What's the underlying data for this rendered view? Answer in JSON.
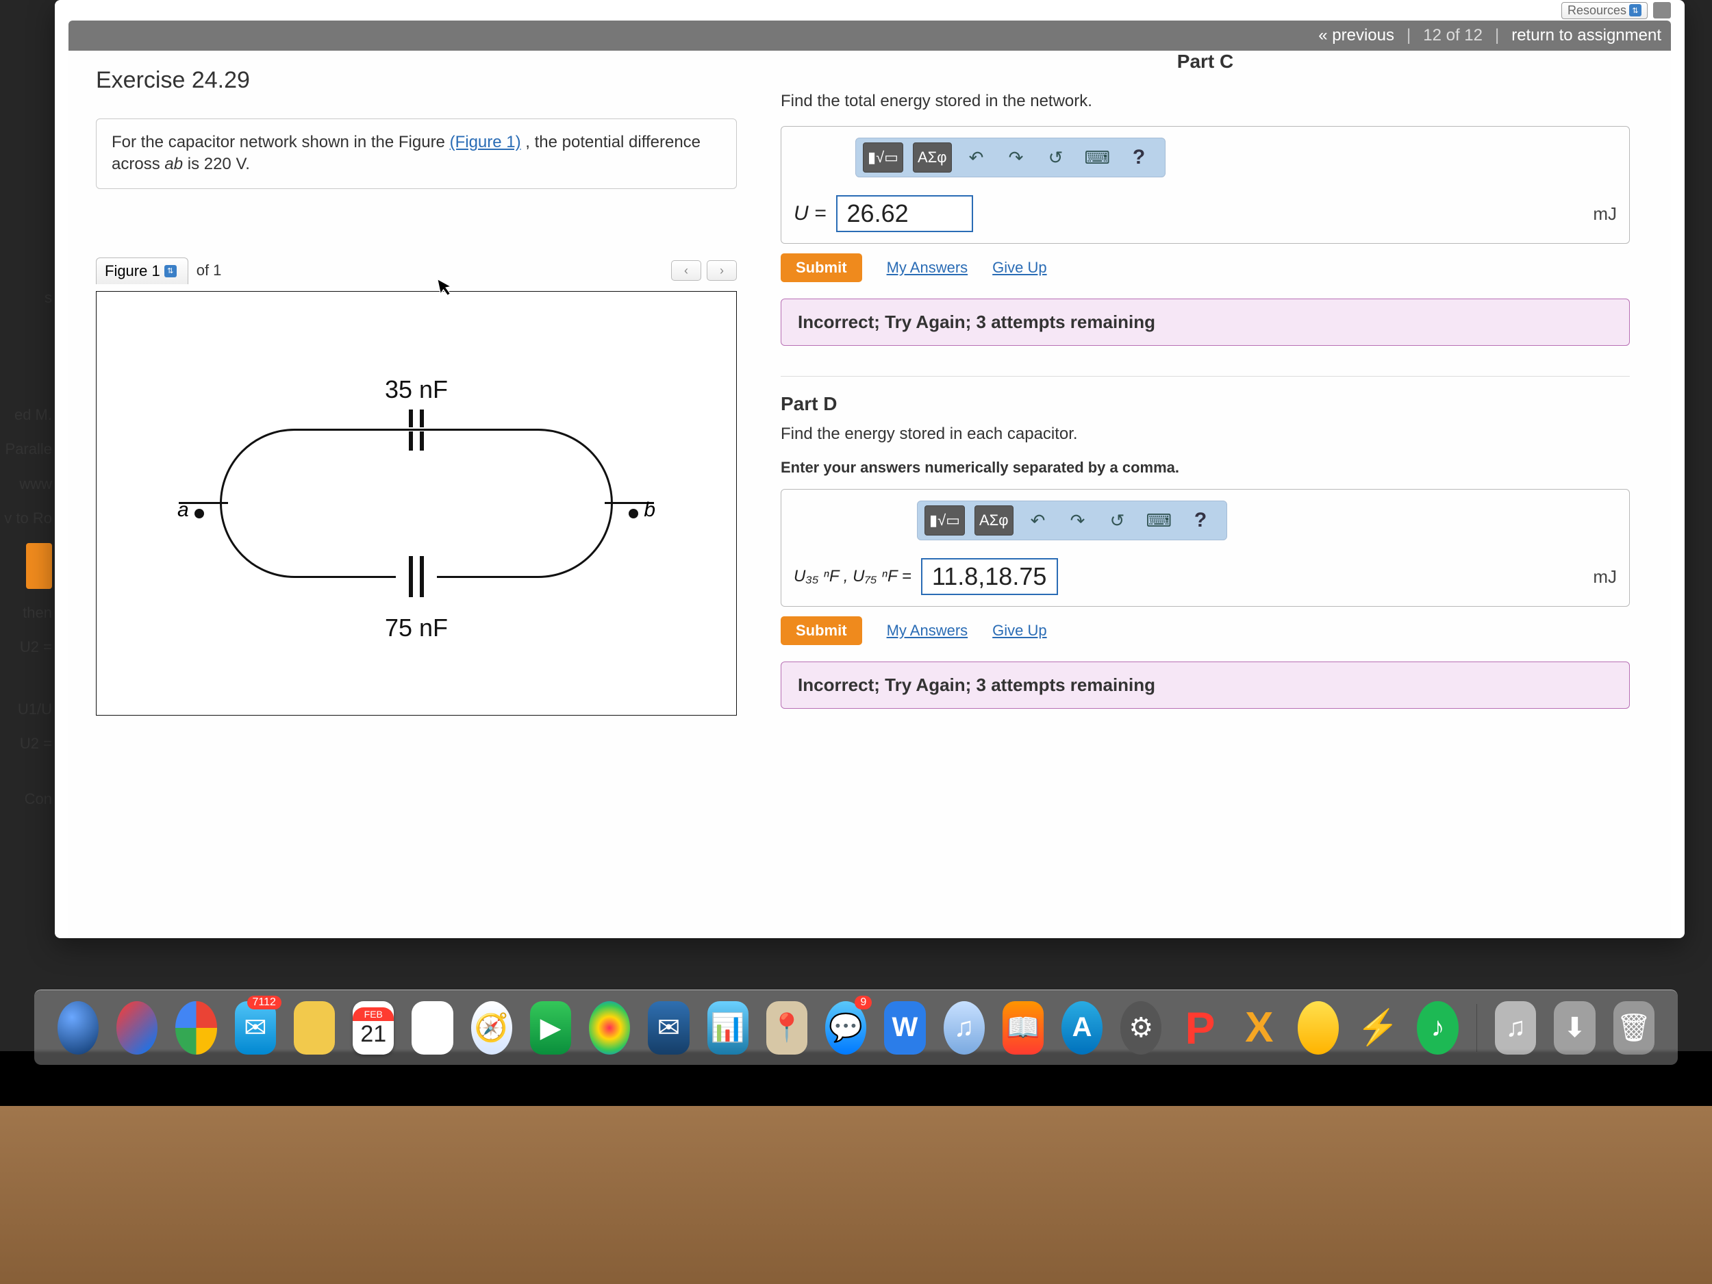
{
  "topbar": {
    "resources": "Resources"
  },
  "nav": {
    "prev": "« previous",
    "pos": "12 of 12",
    "return": "return to assignment"
  },
  "exercise": {
    "title": "Exercise 24.29",
    "prompt_pre": "For the capacitor network shown in the Figure ",
    "prompt_link": "(Figure 1)",
    "prompt_post": " , the potential difference across ",
    "prompt_ab": "ab",
    "prompt_tail": " is 220 V.",
    "fig_tab": "Figure 1",
    "fig_of": "of 1",
    "cap_top": "35 nF",
    "cap_bot": "75 nF",
    "term_a": "a",
    "term_b": "b"
  },
  "partC": {
    "label": "Part C",
    "question": "Find the total energy stored in the network.",
    "toolGreek": "ΑΣφ",
    "eq_lhs": "U =",
    "value": "26.62",
    "unit": "mJ",
    "submit": "Submit",
    "my_answers": "My Answers",
    "give_up": "Give Up",
    "feedback": "Incorrect; Try Again; 3 attempts remaining"
  },
  "partD": {
    "label": "Part D",
    "question": "Find the energy stored in each capacitor.",
    "note": "Enter your answers numerically separated by a comma.",
    "toolGreek": "ΑΣφ",
    "eq_lhs": "U₃₅ ⁿF , U₇₅ ⁿF =",
    "value": "11.8,18.75",
    "unit": "mJ",
    "submit": "Submit",
    "my_answers": "My Answers",
    "give_up": "Give Up",
    "feedback": "Incorrect; Try Again; 3 attempts remaining"
  },
  "sliver": {
    "s1": "s",
    "s2": "ed M.",
    "s3": "Paralle",
    "s4": "www",
    "s5": "v to Ro",
    "s6": "then",
    "s7": "U2 =",
    "s8": "U1/U",
    "s9": "U2 =",
    "s10": "Con"
  },
  "dock": {
    "cal_month": "FEB",
    "cal_day": "21",
    "mail_badge": "7112",
    "msg_badge": "9"
  }
}
